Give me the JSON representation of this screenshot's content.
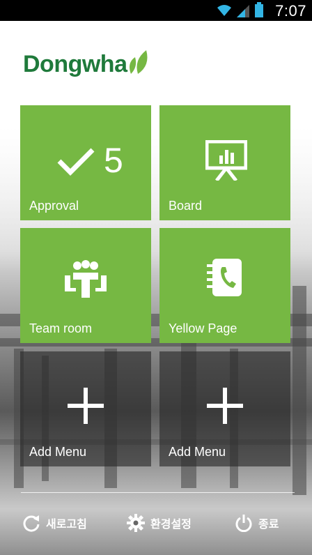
{
  "status_bar": {
    "time": "7:07"
  },
  "app": {
    "logo_text": "Dongwha",
    "tiles": [
      {
        "label": "Approval",
        "badge": "5"
      },
      {
        "label": "Board"
      },
      {
        "label": "Team room"
      },
      {
        "label": "Yellow Page"
      },
      {
        "label": "Add Menu"
      },
      {
        "label": "Add Menu"
      }
    ],
    "bottom_bar": {
      "refresh_label": "새로고침",
      "settings_label": "환경설정",
      "exit_label": "종료"
    }
  },
  "colors": {
    "tile_green": "#76b843",
    "logo_green": "#1f7a3b"
  }
}
